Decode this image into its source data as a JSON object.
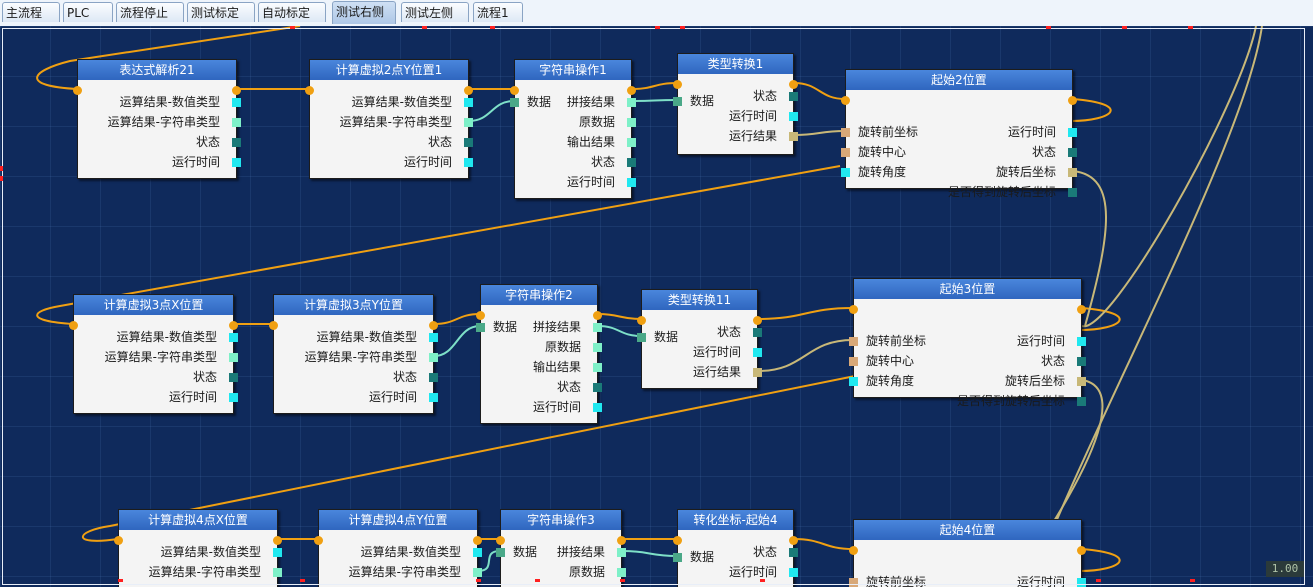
{
  "tabs": [
    {
      "label": "主流程",
      "active": false
    },
    {
      "label": "PLC",
      "active": false
    },
    {
      "label": "流程停止",
      "active": false
    },
    {
      "label": "测试标定",
      "active": false
    },
    {
      "label": "自动标定",
      "active": false
    },
    {
      "label": "测试右侧",
      "active": true
    },
    {
      "label": "测试左侧",
      "active": false
    },
    {
      "label": "流程1",
      "active": false
    }
  ],
  "colors": {
    "canvas": "#0f2a5c",
    "wire_flow": "#f0a012",
    "wire_data": "#7ee0c8",
    "wire_coord": "#c8b878",
    "node_title": "#3a74d0",
    "port_cyan": "#20e8f0",
    "port_mint": "#7ef0c8",
    "port_teal": "#1a7a78",
    "port_tan": "#d8a878",
    "port_olive": "#c8b878",
    "port_green": "#4aa888"
  },
  "zoom": "1.00",
  "nodes": [
    {
      "title": "表达式解析21",
      "outputs": [
        "运算结果-数值类型",
        "运算结果-字符串类型",
        "状态",
        "运行时间"
      ]
    },
    {
      "title": "计算虚拟2点Y位置1",
      "outputs": [
        "运算结果-数值类型",
        "运算结果-字符串类型",
        "状态",
        "运行时间"
      ]
    },
    {
      "title": "字符串操作1",
      "inputs": [
        "数据"
      ],
      "outputs": [
        "拼接结果",
        "原数据",
        "输出结果",
        "状态",
        "运行时间"
      ]
    },
    {
      "title": "类型转换1",
      "inputs": [
        "数据"
      ],
      "outputs": [
        "状态",
        "运行时间",
        "运行结果"
      ]
    },
    {
      "title": "起始2位置",
      "inputs": [
        "旋转前坐标",
        "旋转中心",
        "旋转角度"
      ],
      "outputs": [
        "运行时间",
        "状态",
        "旋转后坐标",
        "是否得到旋转后坐标"
      ]
    },
    {
      "title": "计算虚拟3点X位置",
      "outputs": [
        "运算结果-数值类型",
        "运算结果-字符串类型",
        "状态",
        "运行时间"
      ]
    },
    {
      "title": "计算虚拟3点Y位置",
      "outputs": [
        "运算结果-数值类型",
        "运算结果-字符串类型",
        "状态",
        "运行时间"
      ]
    },
    {
      "title": "字符串操作2",
      "inputs": [
        "数据"
      ],
      "outputs": [
        "拼接结果",
        "原数据",
        "输出结果",
        "状态",
        "运行时间"
      ]
    },
    {
      "title": "类型转换11",
      "inputs": [
        "数据"
      ],
      "outputs": [
        "状态",
        "运行时间",
        "运行结果"
      ]
    },
    {
      "title": "起始3位置",
      "inputs": [
        "旋转前坐标",
        "旋转中心",
        "旋转角度"
      ],
      "outputs": [
        "运行时间",
        "状态",
        "旋转后坐标",
        "是否得到旋转后坐标"
      ]
    },
    {
      "title": "计算虚拟4点X位置",
      "outputs": [
        "运算结果-数值类型",
        "运算结果-字符串类型"
      ]
    },
    {
      "title": "计算虚拟4点Y位置",
      "outputs": [
        "运算结果-数值类型",
        "运算结果-字符串类型"
      ]
    },
    {
      "title": "字符串操作3",
      "inputs": [
        "数据"
      ],
      "outputs": [
        "拼接结果",
        "原数据"
      ]
    },
    {
      "title": "转化坐标-起始4",
      "inputs": [
        "数据"
      ],
      "outputs": [
        "状态",
        "运行时间"
      ]
    },
    {
      "title": "起始4位置",
      "inputs": [
        "旋转前坐标"
      ],
      "outputs": [
        "运行时间"
      ]
    }
  ]
}
